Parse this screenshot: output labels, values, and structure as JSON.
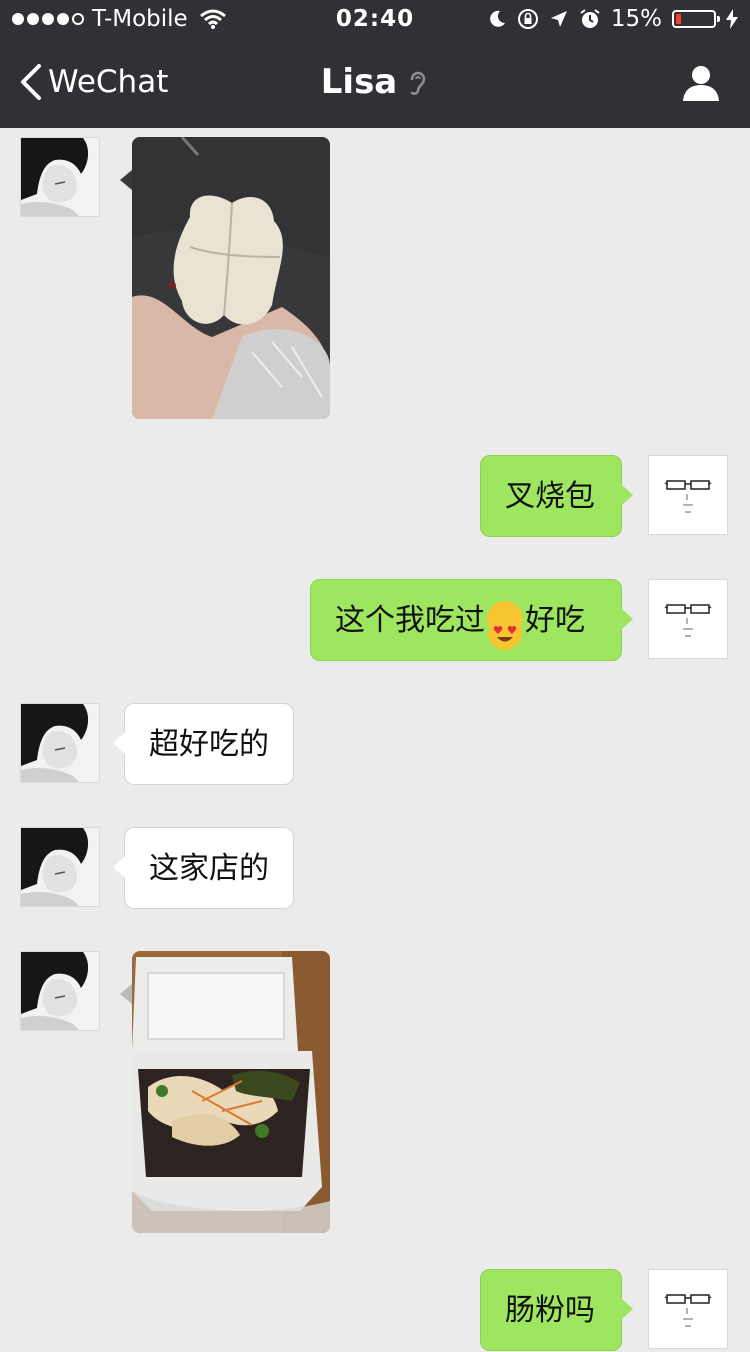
{
  "status_bar": {
    "carrier": "T-Mobile",
    "time": "02:40",
    "battery": "15%",
    "battery_level": 0.15,
    "signal_bars_filled": 4,
    "signal_bars_total": 5
  },
  "nav": {
    "back_label": "WeChat",
    "title": "Lisa"
  },
  "messages": [
    {
      "sender": "Lisa",
      "type": "image",
      "photo": "steamed bun held in hand"
    },
    {
      "sender": "me",
      "type": "text",
      "text": "叉烧包"
    },
    {
      "sender": "me",
      "type": "text",
      "text_before": "这个我吃过",
      "emoji": "heart-eyes-emoji",
      "text_after": "好吃"
    },
    {
      "sender": "Lisa",
      "type": "text",
      "text": "超好吃的"
    },
    {
      "sender": "Lisa",
      "type": "text",
      "text": "这家店的"
    },
    {
      "sender": "Lisa",
      "type": "image",
      "photo": "rice noodle rolls in takeout box"
    },
    {
      "sender": "me",
      "type": "text",
      "text": "肠粉吗"
    }
  ],
  "colors": {
    "nav_bg": "#303134",
    "chat_bg": "#ebebeb",
    "outgoing_bubble": "#9fe660",
    "incoming_bubble": "#ffffff",
    "battery_low": "#ff3b30"
  }
}
